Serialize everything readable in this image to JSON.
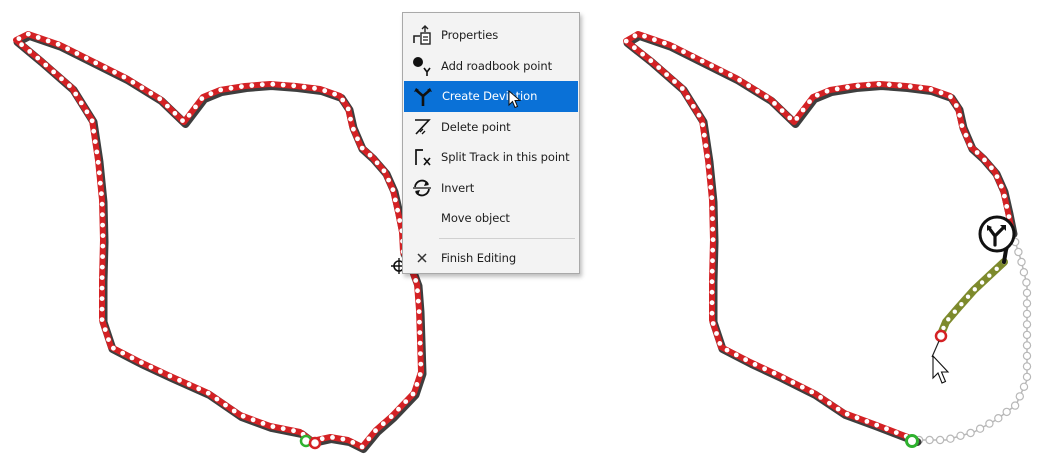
{
  "context_menu": {
    "items": [
      {
        "id": "properties",
        "label": "Properties",
        "icon": "properties-icon"
      },
      {
        "id": "add-roadbook-point",
        "label": "Add roadbook point",
        "icon": "roadbook-point-icon"
      },
      {
        "id": "create-deviation",
        "label": "Create Deviation",
        "icon": "deviation-icon",
        "selected": true
      },
      {
        "id": "delete-point",
        "label": "Delete point",
        "icon": "delete-point-icon"
      },
      {
        "id": "split-track",
        "label": "Split Track in this point",
        "icon": "split-track-icon"
      },
      {
        "id": "invert",
        "label": "Invert",
        "icon": "invert-icon"
      },
      {
        "id": "move-object",
        "label": "Move object",
        "icon": ""
      }
    ],
    "finish": {
      "id": "finish-editing",
      "label": "Finish Editing",
      "icon": "close-icon"
    }
  },
  "colors": {
    "track": "#d42124",
    "track_shadow": "#1c1c1c",
    "track_point": "#ffffff",
    "deviation_segment": "#7d8a2c",
    "start_marker": "#2fb12f",
    "end_marker": "#d42124",
    "ghost_track": "#b8b8b8",
    "menu_selected": "#0a71d7"
  }
}
